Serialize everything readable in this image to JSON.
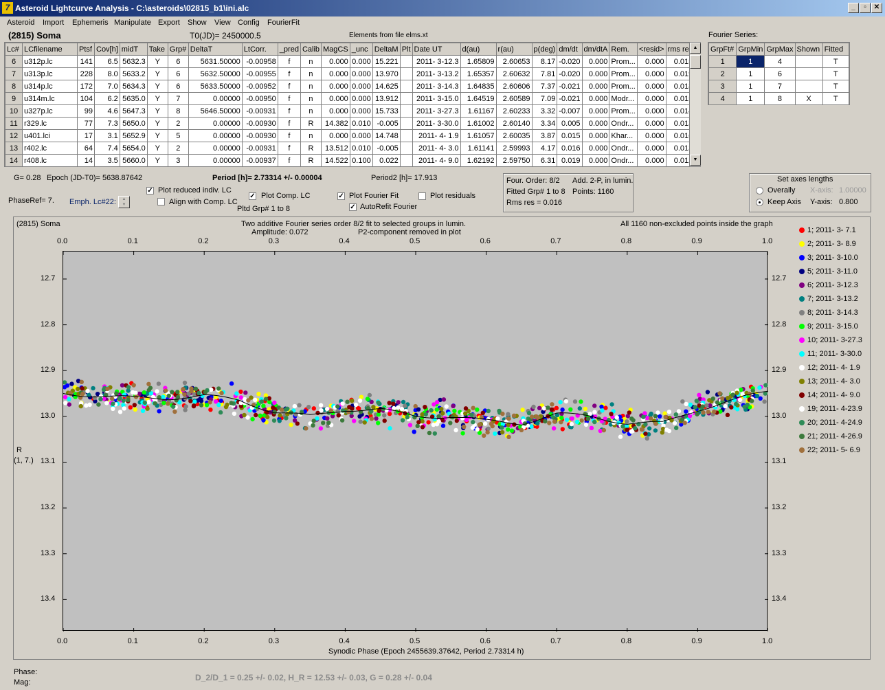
{
  "window": {
    "title": "Asteroid Lightcurve Analysis - C:\\asteroids\\02815_b1\\ini.alc",
    "min": "_",
    "max": "▫",
    "close": "✕"
  },
  "menu": [
    "Asteroid",
    "Import",
    "Ephemeris",
    "Manipulate",
    "Export",
    "Show",
    "View",
    "Config",
    "FourierFit"
  ],
  "header": {
    "asteroid": "(2815) Soma",
    "t0": "T0(JD)= 2450000.5",
    "elements": "Elements from file elms.xt"
  },
  "lc_table": {
    "columns": [
      "Lc#",
      "LCfilename",
      "Ptsf",
      "Cov[h]",
      "midT",
      "Take",
      "Grp#",
      "DeltaT",
      "LtCorr.",
      "_pred",
      "Calib",
      "MagCS",
      "_unc",
      "DeltaM",
      "Plt",
      "Date UT",
      "d(au)",
      "r(au)",
      "p(deg)",
      "dm/dt",
      "dm/dtA",
      "Rem.",
      "<resid>",
      "rms res"
    ],
    "rows": [
      [
        "6",
        "u312p.lc",
        "141",
        "6.5",
        "5632.3",
        "Y",
        "6",
        "5631.50000",
        "-0.00958",
        "f",
        "n",
        "0.000",
        "0.000",
        "15.221",
        "",
        "2011- 3-12.3",
        "1.65809",
        "2.60653",
        "8.17",
        "-0.020",
        "0.000",
        "Prom...",
        "0.000",
        "0.015"
      ],
      [
        "7",
        "u313p.lc",
        "228",
        "8.0",
        "5633.2",
        "Y",
        "6",
        "5632.50000",
        "-0.00955",
        "f",
        "n",
        "0.000",
        "0.000",
        "13.970",
        "",
        "2011- 3-13.2",
        "1.65357",
        "2.60632",
        "7.81",
        "-0.020",
        "0.000",
        "Prom...",
        "0.000",
        "0.019"
      ],
      [
        "8",
        "u314p.lc",
        "172",
        "7.0",
        "5634.3",
        "Y",
        "6",
        "5633.50000",
        "-0.00952",
        "f",
        "n",
        "0.000",
        "0.000",
        "14.625",
        "",
        "2011- 3-14.3",
        "1.64835",
        "2.60606",
        "7.37",
        "-0.021",
        "0.000",
        "Prom...",
        "0.000",
        "0.018"
      ],
      [
        "9",
        "u314m.lc",
        "104",
        "6.2",
        "5635.0",
        "Y",
        "7",
        "0.00000",
        "-0.00950",
        "f",
        "n",
        "0.000",
        "0.000",
        "13.912",
        "",
        "2011- 3-15.0",
        "1.64519",
        "2.60589",
        "7.09",
        "-0.021",
        "0.000",
        "Modr...",
        "0.000",
        "0.015"
      ],
      [
        "10",
        "u327p.lc",
        "99",
        "4.6",
        "5647.3",
        "Y",
        "8",
        "5646.50000",
        "-0.00931",
        "f",
        "n",
        "0.000",
        "0.000",
        "15.733",
        "",
        "2011- 3-27.3",
        "1.61167",
        "2.60233",
        "3.32",
        "-0.007",
        "0.000",
        "Prom...",
        "0.000",
        "0.014"
      ],
      [
        "11",
        "r329.lc",
        "77",
        "7.3",
        "5650.0",
        "Y",
        "2",
        "0.00000",
        "-0.00930",
        "f",
        "R",
        "14.382",
        "0.010",
        "-0.005",
        "",
        "2011- 3-30.0",
        "1.61002",
        "2.60140",
        "3.34",
        "0.005",
        "0.000",
        "Ondr...",
        "0.000",
        "0.013"
      ],
      [
        "12",
        "u401.lci",
        "17",
        "3.1",
        "5652.9",
        "Y",
        "5",
        "0.00000",
        "-0.00930",
        "f",
        "n",
        "0.000",
        "0.000",
        "14.748",
        "",
        "2011- 4- 1.9",
        "1.61057",
        "2.60035",
        "3.87",
        "0.015",
        "0.000",
        "Khar...",
        "0.000",
        "0.016"
      ],
      [
        "13",
        "r402.lc",
        "64",
        "7.4",
        "5654.0",
        "Y",
        "2",
        "0.00000",
        "-0.00931",
        "f",
        "R",
        "13.512",
        "0.010",
        "-0.005",
        "",
        "2011- 4- 3.0",
        "1.61141",
        "2.59993",
        "4.17",
        "0.016",
        "0.000",
        "Ondr...",
        "0.000",
        "0.013"
      ],
      [
        "14",
        "r408.lc",
        "14",
        "3.5",
        "5660.0",
        "Y",
        "3",
        "0.00000",
        "-0.00937",
        "f",
        "R",
        "14.522",
        "0.100",
        "0.022",
        "",
        "2011- 4- 9.0",
        "1.62192",
        "2.59750",
        "6.31",
        "0.019",
        "0.000",
        "Ondr...",
        "0.000",
        "0.012"
      ]
    ]
  },
  "fourier": {
    "title": "Fourier Series:",
    "columns": [
      "GrpFt#",
      "GrpMin",
      "GrpMax",
      "Shown",
      "Fitted"
    ],
    "rows": [
      [
        "1",
        "1",
        "4",
        "",
        "T"
      ],
      [
        "2",
        "1",
        "6",
        "",
        "T"
      ],
      [
        "3",
        "1",
        "7",
        "",
        "T"
      ],
      [
        "4",
        "1",
        "8",
        "X",
        "T"
      ]
    ]
  },
  "controls": {
    "g": "G= 0.28",
    "epoch": "Epoch (JD-T0)= 5638.87642",
    "period": "Period [h]= 2.73314 +/- 0.00004",
    "period2": "Period2 [h]= 17.913",
    "phaseref": "PhaseRef= 7.",
    "emph": "Emph. Lc#22:",
    "plot_reduced": "Plot reduced indiv. LC",
    "align_comp": "Align with Comp. LC",
    "plot_comp": "Plot Comp. LC",
    "pltd_grp": "Pltd Grp#  1   to    8",
    "plot_fourier": "Plot Fourier Fit",
    "autorefit": "AutoRefit Fourier",
    "plot_residuals": "Plot residuals",
    "info1a": "Four. Order:  8/2",
    "info1b": "Add. 2-P, in lumin.",
    "info2a": "Fitted Grp# 1 to 8",
    "info2b": "Points: 1160",
    "info3": "Rms res     = 0.016",
    "axes_title": "Set axes lengths",
    "overally": "Overally",
    "keepaxis": "Keep Axis",
    "xaxis_lbl": "X-axis:",
    "xaxis_val": "1.00000",
    "yaxis_lbl": "Y-axis:",
    "yaxis_val": "0.800"
  },
  "plot": {
    "name": "(2815) Soma",
    "title1": "Two additive Fourier series order 8/2 fit to selected groups in lumin.",
    "title2a": "Amplitude: 0.072",
    "title2b": "P2-component removed in plot",
    "right_note": "All 1160 non-excluded points inside the graph",
    "ylabel1": "R",
    "ylabel2": "(1, 7.)",
    "xlabel": "Synodic Phase (Epoch 2455639.37642, Period 2.73314 h)"
  },
  "chart_data": {
    "type": "scatter",
    "xlim": [
      0.0,
      1.0
    ],
    "ylim": [
      12.64,
      13.47
    ],
    "y_inverted": true,
    "x_ticks": [
      "0.0",
      "0.1",
      "0.2",
      "0.3",
      "0.4",
      "0.5",
      "0.6",
      "0.7",
      "0.8",
      "0.9",
      "1.0"
    ],
    "y_ticks": [
      "12.7",
      "12.8",
      "12.9",
      "13.0",
      "13.1",
      "13.2",
      "13.3",
      "13.4"
    ],
    "fit_curve": {
      "x": [
        0.0,
        0.05,
        0.1,
        0.15,
        0.2,
        0.25,
        0.3,
        0.35,
        0.4,
        0.45,
        0.5,
        0.55,
        0.6,
        0.65,
        0.7,
        0.75,
        0.8,
        0.85,
        0.9,
        0.95,
        1.0
      ],
      "y": [
        12.95,
        12.955,
        12.96,
        12.96,
        12.955,
        12.965,
        12.99,
        13.0,
        12.985,
        12.985,
        13.0,
        13.0,
        13.01,
        13.015,
        12.995,
        13.0,
        13.015,
        13.015,
        12.985,
        12.965,
        12.945
      ]
    },
    "series": [
      {
        "name": "1; 2011- 3- 7.1",
        "color": "#ff0000"
      },
      {
        "name": "2; 2011- 3- 8.9",
        "color": "#ffff00"
      },
      {
        "name": "3; 2011- 3-10.0",
        "color": "#0000ff"
      },
      {
        "name": "5; 2011- 3-11.0",
        "color": "#000080"
      },
      {
        "name": "6; 2011- 3-12.3",
        "color": "#800080"
      },
      {
        "name": "7; 2011- 3-13.2",
        "color": "#008080"
      },
      {
        "name": "8; 2011- 3-14.3",
        "color": "#808080"
      },
      {
        "name": "9; 2011- 3-15.0",
        "color": "#00ff00"
      },
      {
        "name": "10; 2011- 3-27.3",
        "color": "#ff00ff"
      },
      {
        "name": "11; 2011- 3-30.0",
        "color": "#00ffff"
      },
      {
        "name": "12; 2011- 4- 1.9",
        "color": "#ffffff"
      },
      {
        "name": "13; 2011- 4- 3.0",
        "color": "#808000"
      },
      {
        "name": "14; 2011- 4- 9.0",
        "color": "#800000"
      },
      {
        "name": "19; 2011- 4-23.9",
        "color": "#ffffff"
      },
      {
        "name": "20; 2011- 4-24.9",
        "color": "#2e8b57"
      },
      {
        "name": "21; 2011- 4-26.9",
        "color": "#3c7a3c"
      },
      {
        "name": "22; 2011- 5- 6.9",
        "color": "#a0703c"
      }
    ],
    "scatter_half_width": 0.022
  },
  "footer": {
    "phase": "Phase:",
    "mag": "Mag:",
    "result": "D_2/D_1 = 0.25 +/- 0.02, H_R = 12.53 +/- 0.03, G = 0.28 +/- 0.04"
  }
}
